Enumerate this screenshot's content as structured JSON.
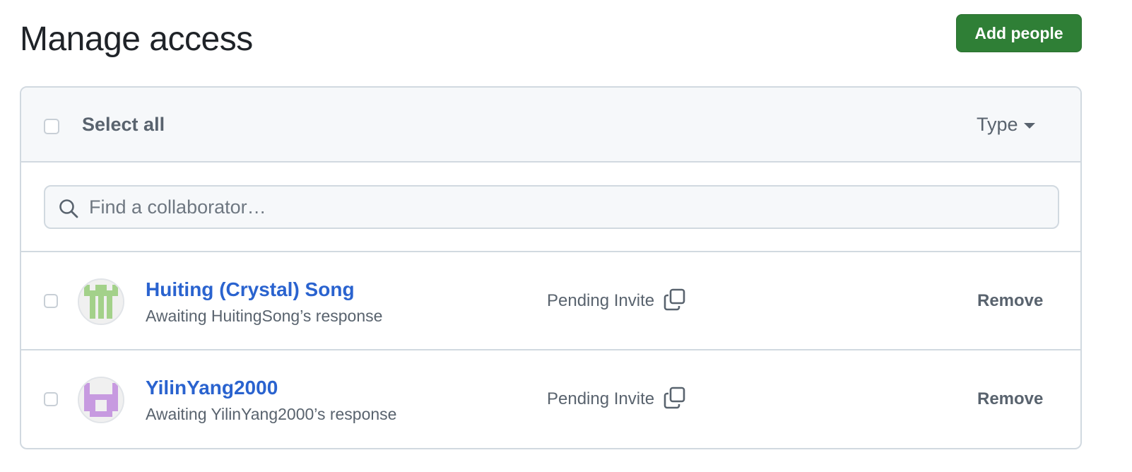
{
  "page": {
    "title": "Manage access",
    "add_button_label": "Add people"
  },
  "colors": {
    "accent_green": "#2f7f36",
    "link_blue": "#2a63cf",
    "muted_text": "#59636e",
    "border": "#d1d9e0",
    "header_bg": "#f6f8fa"
  },
  "list_header": {
    "select_all_label": "Select all",
    "type_filter_label": "Type"
  },
  "search": {
    "placeholder": "Find a collaborator…",
    "value": ""
  },
  "collaborators": [
    {
      "name": "Huiting (Crystal) Song",
      "subtitle": "Awaiting HuitingSong’s response",
      "status": "Pending Invite",
      "action": "Remove",
      "avatar_icon": "identicon-green"
    },
    {
      "name": "YilinYang2000",
      "subtitle": "Awaiting YilinYang2000’s response",
      "status": "Pending Invite",
      "action": "Remove",
      "avatar_icon": "identicon-purple"
    }
  ]
}
